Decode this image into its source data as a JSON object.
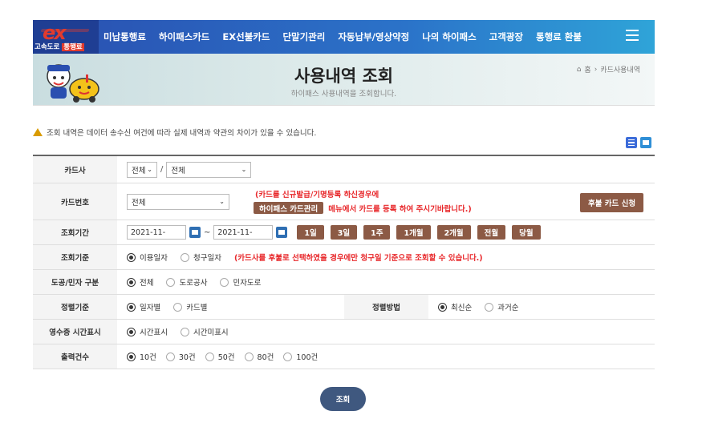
{
  "header": {
    "logo_text": "ex",
    "logo_tag_1": "고속도로",
    "logo_tag_2": "통행료",
    "nav": [
      "미납통행료",
      "하이패스카드",
      "EX선불카드",
      "단말기관리",
      "자동납부/영상약정",
      "나의 하이패스",
      "고객광장",
      "통행료 환불"
    ]
  },
  "banner": {
    "title": "사용내역 조회",
    "subtitle": "하이패스 사용내역을 조회합니다.",
    "breadcrumb_home": "홈",
    "breadcrumb_current": "카드사용내역"
  },
  "notice": "조회 내역은 데이터 송수신 여건에 따라 실제 내역과 약관의 차이가 있을 수 있습니다.",
  "form": {
    "card_company": {
      "label": "카드사",
      "select1": "전체",
      "select2": "전체"
    },
    "card_number": {
      "label": "카드번호",
      "select": "전체",
      "note_line1": "(카드를 신규발급/기명등록 하신경우에",
      "note_button": "하이패스 카드관리",
      "note_line2": "메뉴에서 카드를 등록 하여 주시기바랍니다.)",
      "apply_button": "후불 카드 신청"
    },
    "period": {
      "label": "조회기간",
      "from": "2021-11-",
      "to": "2021-11-",
      "tilde": "~",
      "buttons": [
        "1일",
        "3일",
        "1주",
        "1개월",
        "2개월",
        "전월",
        "당월"
      ]
    },
    "basis": {
      "label": "조회기준",
      "options": [
        "이용일자",
        "청구일자"
      ],
      "selected": 0,
      "note": "(카드사를 후불로 선택하였을 경우에만 청구일 기준으로 조회할 수 있습니다.)"
    },
    "road": {
      "label": "도공/민자 구분",
      "options": [
        "전체",
        "도로공사",
        "민자도로"
      ],
      "selected": 0
    },
    "sort": {
      "label": "정렬기준",
      "options": [
        "일자별",
        "카드별"
      ],
      "selected": 0
    },
    "order": {
      "label": "정렬방법",
      "options": [
        "최신순",
        "과거순"
      ],
      "selected": 0
    },
    "receipt": {
      "label": "영수증 시간표시",
      "options": [
        "시간표시",
        "시간미표시"
      ],
      "selected": 0
    },
    "count": {
      "label": "출력건수",
      "options": [
        "10건",
        "30건",
        "50건",
        "80건",
        "100건"
      ],
      "selected": 0
    }
  },
  "submit_label": "조회",
  "colors": {
    "nav_blue": "#2b73c9",
    "brown_button": "#8c5a45",
    "submit": "#3f587f",
    "red_note": "#e8282b"
  }
}
